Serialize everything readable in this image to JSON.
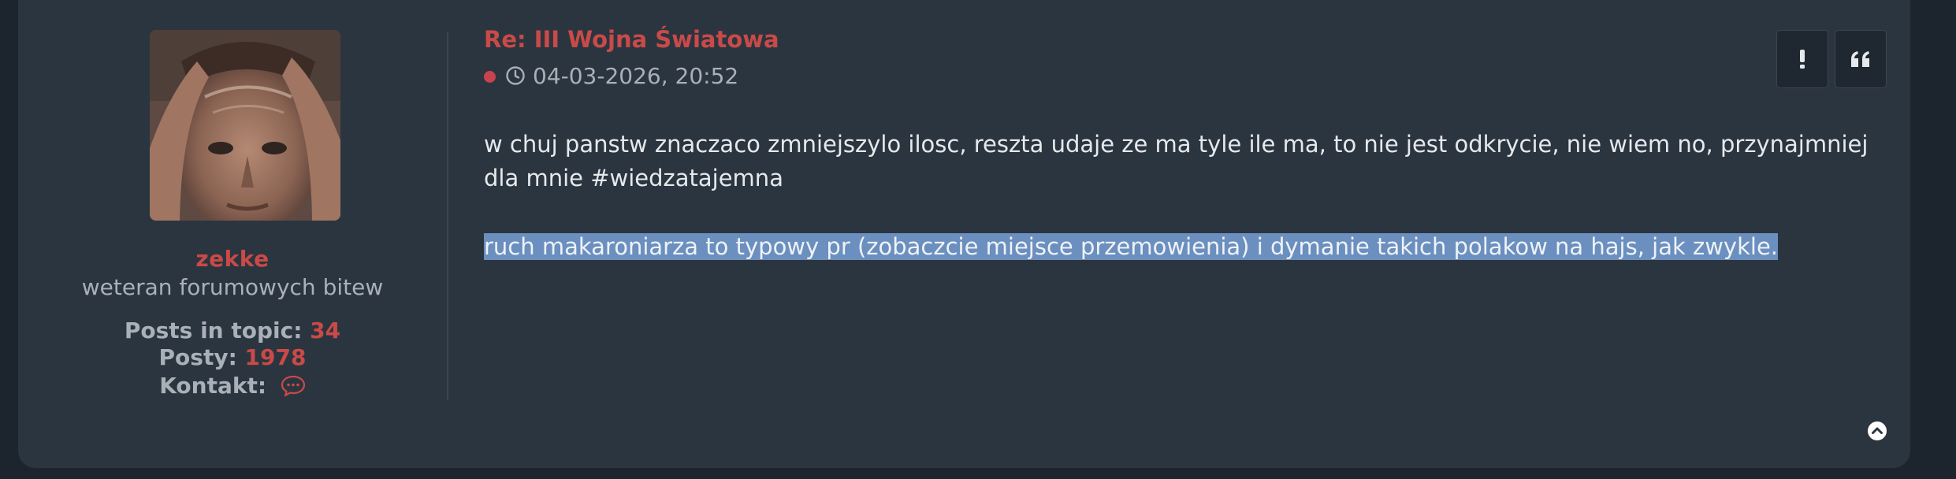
{
  "profile": {
    "username": "zekke",
    "rank": "weteran forumowych bitew",
    "stats": {
      "topic_label": "Posts in topic:",
      "topic_value": "34",
      "posts_label": "Posty:",
      "posts_value": "1978",
      "contact_label": "Kontakt:"
    }
  },
  "post": {
    "title": "Re: III Wojna Światowa",
    "datetime": "04-03-2026, 20:52",
    "paragraphs": [
      "w chuj panstw znaczaco zmniejszylo ilosc, reszta udaje ze ma tyle ile ma, to nie jest odkrycie, nie wiem no, przynajmniej dla mnie #wiedzatajemna",
      "ruch makaroniarza to typowy pr (zobaczcie miejsce przemowienia) i dymanie takich polakow na hajs, jak zwykle."
    ],
    "actions": [
      {
        "icon": "report-icon"
      },
      {
        "icon": "quote-icon"
      }
    ],
    "back_to_top_icon": "chevron-up-circle-icon"
  },
  "colors": {
    "page_bg": "#1c242d",
    "panel_bg": "#2b3540",
    "accent": "#c94a47",
    "muted_text": "#a9b0b8",
    "body_text": "#e6e9ec",
    "selection": "#6b8fbf"
  }
}
